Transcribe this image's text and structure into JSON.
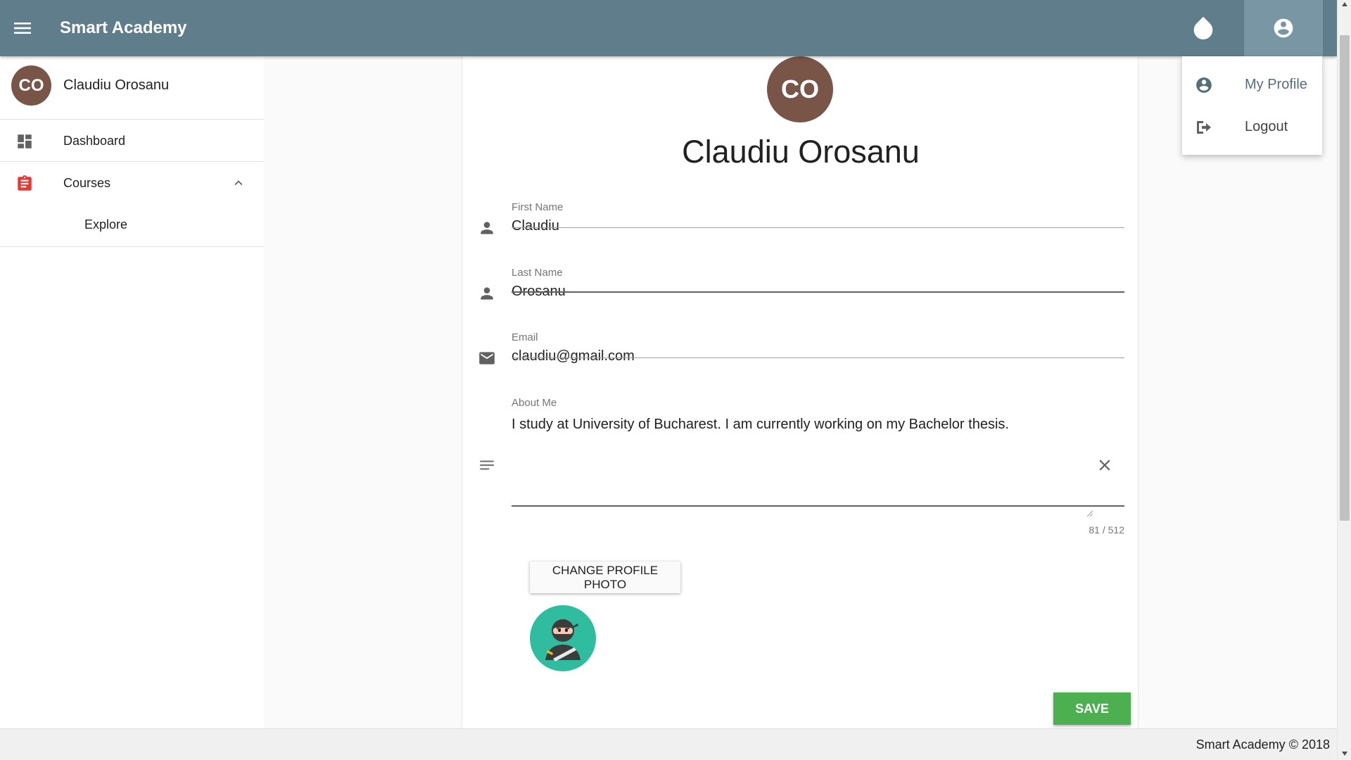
{
  "app": {
    "title": "Smart Academy",
    "menu_icon": "menu-icon",
    "theme_icon": "invert-colors-icon",
    "account_icon": "account-circle-icon",
    "brand_color": "#607d8b"
  },
  "account_menu": {
    "items": [
      {
        "label": "My Profile",
        "icon": "account-circle-icon"
      },
      {
        "label": "Logout",
        "icon": "logout-icon"
      }
    ]
  },
  "sidebar": {
    "user": {
      "initials": "CO",
      "name": "Claudiu Orosanu",
      "avatar_color": "#795548"
    },
    "items": [
      {
        "label": "Dashboard",
        "icon": "dashboard-icon"
      },
      {
        "label": "Courses",
        "icon": "assignment-icon",
        "accent": "#e53935",
        "expanded": true,
        "children": [
          {
            "label": "Explore"
          }
        ]
      }
    ]
  },
  "profile": {
    "initials": "CO",
    "name": "Claudiu Orosanu",
    "fields": {
      "first_name": {
        "label": "First Name",
        "value": "Claudiu",
        "icon": "person-icon"
      },
      "last_name": {
        "label": "Last Name",
        "value": "Orosanu",
        "icon": "person-icon"
      },
      "email": {
        "label": "Email",
        "value": "claudiu@gmail.com",
        "icon": "email-icon"
      },
      "about": {
        "label": "About Me",
        "value": "I study at University of Bucharest. I am currently working on my Bachelor thesis.",
        "icon": "notes-icon",
        "counter": "81 / 512"
      }
    },
    "change_photo_label": "CHANGE PROFILE PHOTO",
    "photo_icon": "ninja-avatar-icon",
    "save_label": "SAVE",
    "save_color": "#4caf50"
  },
  "footer": {
    "text": "Smart Academy © 2018"
  }
}
